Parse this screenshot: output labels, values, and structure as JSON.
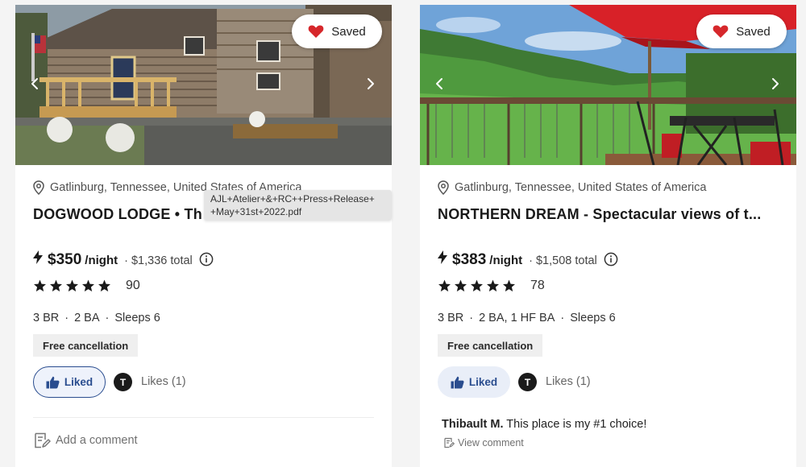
{
  "listings": [
    {
      "saved_label": "Saved",
      "location": "Gatlinburg, Tennessee, United States of America",
      "title": "DOGWOOD LODGE • Th",
      "price": "$350",
      "per_night": "/night",
      "total": "· $1,336 total",
      "rating": 5,
      "review_count": "90",
      "specs": [
        "3 BR",
        "2 BA",
        "Sleeps 6"
      ],
      "badge": "Free cancellation",
      "liked_label": "Liked",
      "avatar_initial": "T",
      "likes_count": "Likes (1)",
      "add_comment": "Add a comment",
      "tooltip": "AJL+Atelier+&+RC++Press+Release+\n+May+31st+2022.pdf",
      "photo_icon": "log-cabin-photo"
    },
    {
      "saved_label": "Saved",
      "location": "Gatlinburg, Tennessee, United States of America",
      "title": "NORTHERN DREAM - Spectacular views of t...",
      "price": "$383",
      "per_night": "/night",
      "total": "· $1,508 total",
      "rating": 5,
      "review_count": "78",
      "specs": [
        "3 BR",
        "2 BA, 1 HF BA",
        "Sleeps 6"
      ],
      "badge": "Free cancellation",
      "liked_label": "Liked",
      "avatar_initial": "T",
      "likes_count": "Likes (1)",
      "comment_author": "Thibault M.",
      "comment_text": "This place is my #1 choice!",
      "view_comment": "View comment",
      "photo_icon": "mountain-deck-photo"
    }
  ],
  "colors": {
    "saved_heart": "#d6272b",
    "liked_text": "#2a4d8f",
    "badge_bg": "#efefef"
  }
}
